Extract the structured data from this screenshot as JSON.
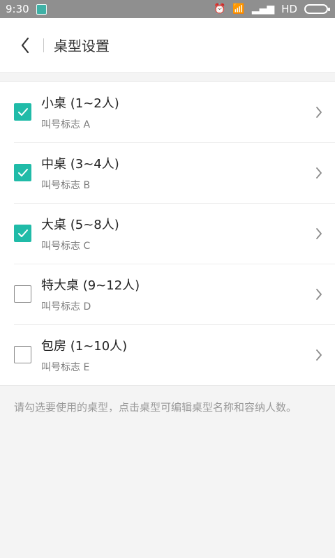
{
  "status": {
    "time": "9:30",
    "network": "HD"
  },
  "header": {
    "title": "桌型设置"
  },
  "items": [
    {
      "title": "小桌 (1~2人)",
      "sub": "叫号标志 A",
      "checked": true
    },
    {
      "title": "中桌 (3~4人)",
      "sub": "叫号标志 B",
      "checked": true
    },
    {
      "title": "大桌 (5~8人)",
      "sub": "叫号标志 C",
      "checked": true
    },
    {
      "title": "特大桌 (9~12人)",
      "sub": "叫号标志 D",
      "checked": false
    },
    {
      "title": "包房 (1~10人)",
      "sub": "叫号标志 E",
      "checked": false
    }
  ],
  "hint": "请勾选要使用的桌型，点击桌型可编辑桌型名称和容纳人数。",
  "colors": {
    "accent": "#20bba8"
  },
  "icons": {
    "back": "back-arrow-icon",
    "chevron": "chevron-right-icon",
    "check": "checkmark-icon"
  }
}
